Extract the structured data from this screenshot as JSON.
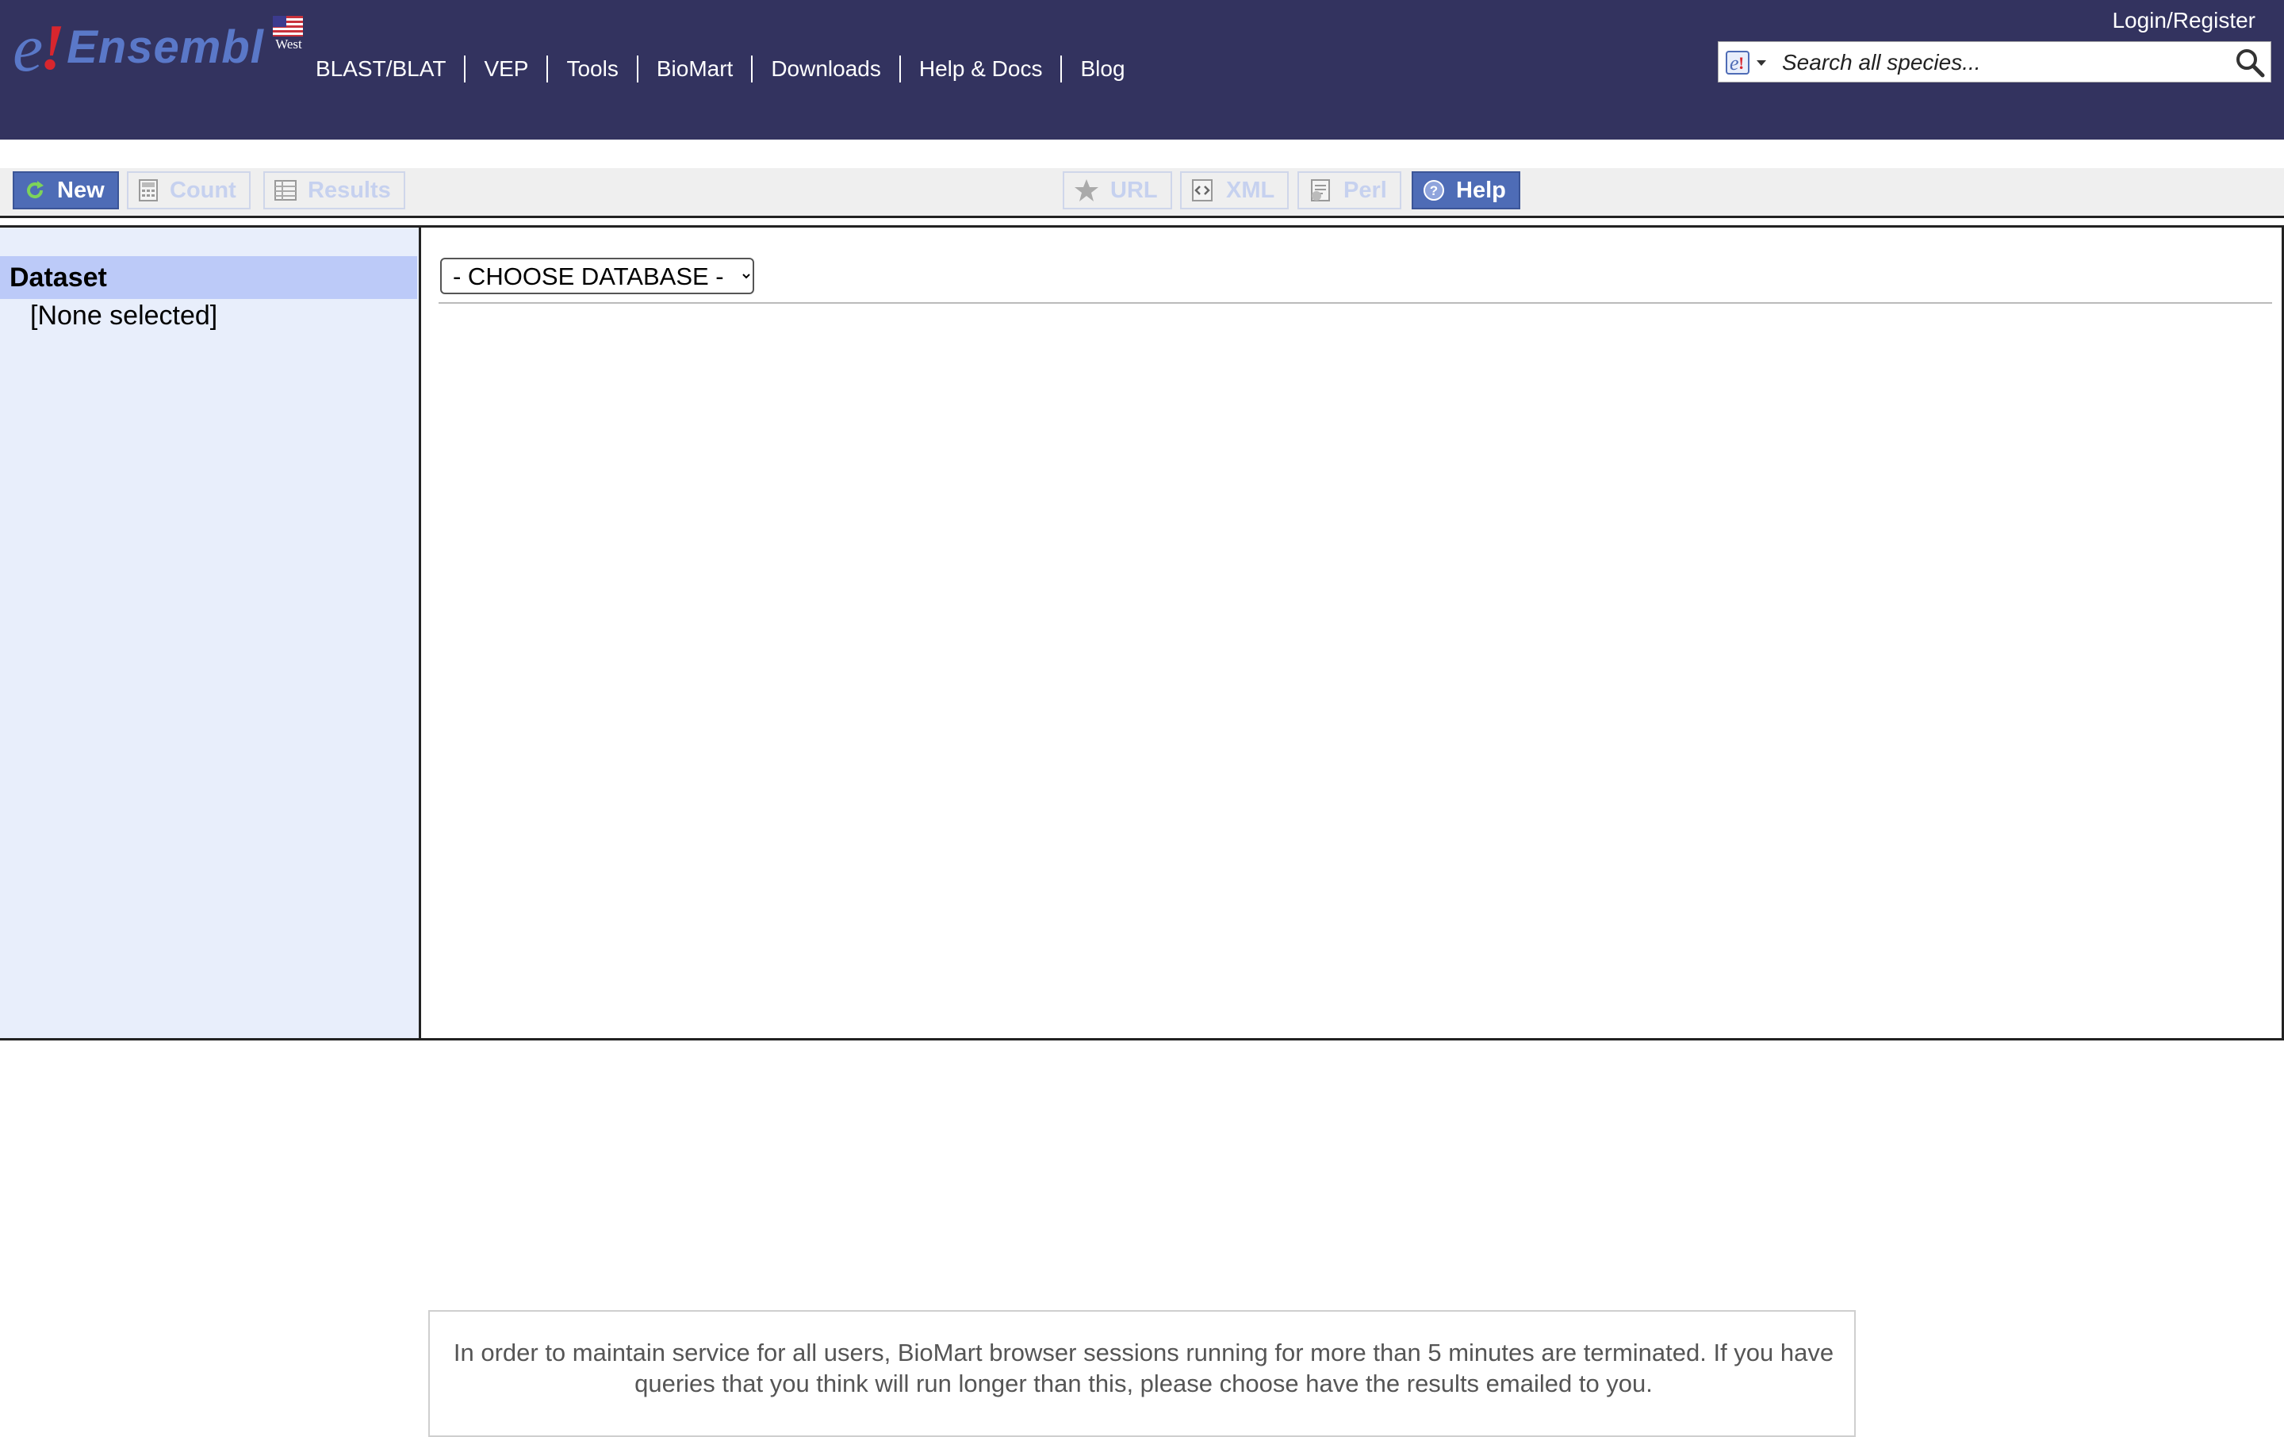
{
  "masthead": {
    "logo_text": "Ensembl",
    "region_label": "West",
    "nav": [
      "BLAST/BLAT",
      "VEP",
      "Tools",
      "BioMart",
      "Downloads",
      "Help & Docs",
      "Blog"
    ],
    "login": "Login/Register",
    "search": {
      "placeholder": "Search all species..."
    }
  },
  "toolbar": {
    "new": "New",
    "count": "Count",
    "results": "Results",
    "url": "URL",
    "xml": "XML",
    "perl": "Perl",
    "help": "Help"
  },
  "sidebar": {
    "heading": "Dataset",
    "value": "[None selected]"
  },
  "main": {
    "database_select": "- CHOOSE DATABASE -"
  },
  "notice": "In order to maintain service for all users, BioMart browser sessions running for more than 5 minutes are terminated. If you have queries that you think will run longer than this, please choose have the results emailed to you.",
  "colors": {
    "masthead": "#33335f",
    "active_button": "#4e6cb6",
    "sidebar_bg": "#e8eefb",
    "sidebar_heading": "#bccaf8"
  }
}
